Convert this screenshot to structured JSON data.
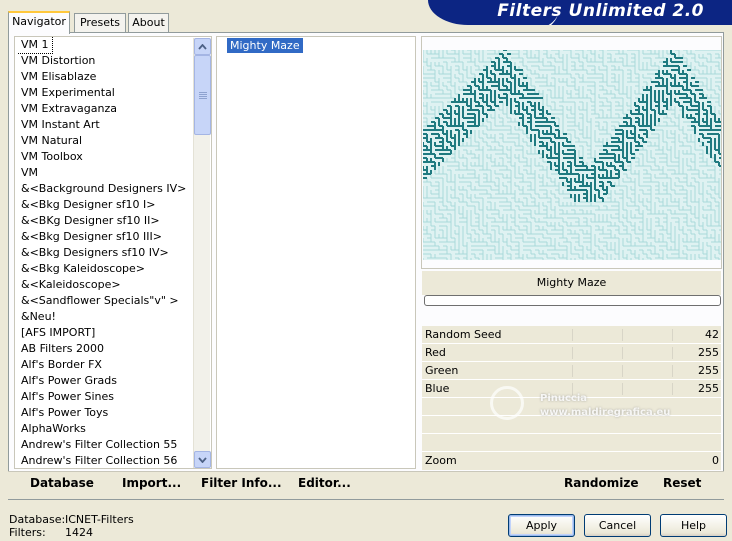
{
  "banner": {
    "title": "Filters Unlimited 2.0"
  },
  "tabs": [
    {
      "label": "Navigator",
      "active": true
    },
    {
      "label": "Presets",
      "active": false
    },
    {
      "label": "About",
      "active": false
    }
  ],
  "categories": [
    "VM 1",
    "VM Distortion",
    "VM Elisablaze",
    "VM Experimental",
    "VM Extravaganza",
    "VM Instant Art",
    "VM Natural",
    "VM Toolbox",
    "VM",
    "&<Background Designers IV>",
    "&<Bkg Designer sf10 I>",
    "&<BKg Designer sf10 II>",
    "&<Bkg Designer sf10 III>",
    "&<Bkg Designers sf10 IV>",
    "&<Bkg Kaleidoscope>",
    "&<Kaleidoscope>",
    "&<Sandflower Specials\"v\" >",
    "&Neu!",
    "[AFS IMPORT]",
    "AB Filters 2000",
    "Alf's Border FX",
    "Alf's Power Grads",
    "Alf's Power Sines",
    "Alf's Power Toys",
    "AlphaWorks",
    "Andrew's Filter Collection 55",
    "Andrew's Filter Collection 56"
  ],
  "selected_category": "VM 1",
  "filters": {
    "selected": "Mighty Maze"
  },
  "preview": {
    "filter_name": "Mighty Maze",
    "maze_color": "#1f7a80",
    "bg_color": "#dff2f2"
  },
  "params": [
    {
      "label": "Random Seed",
      "value": "42"
    },
    {
      "label": "Red",
      "value": "255"
    },
    {
      "label": "Green",
      "value": "255"
    },
    {
      "label": "Blue",
      "value": "255"
    }
  ],
  "zoom": {
    "label": "Zoom",
    "value": "0"
  },
  "toolbar": {
    "database": "Database",
    "import": "Import...",
    "filter_info": "Filter Info...",
    "editor": "Editor...",
    "randomize": "Randomize",
    "reset": "Reset"
  },
  "footer": {
    "database_label": "Database:",
    "database_value": "ICNET-Filters",
    "filters_label": "Filters:",
    "filters_value": "1424"
  },
  "buttons": {
    "apply": "Apply",
    "cancel": "Cancel",
    "help": "Help"
  },
  "watermark": {
    "line1": "Pinuccia",
    "line2": "www.maldiregrafica.eu"
  },
  "colors": {
    "accent": "#316ac5",
    "banner": "#0c2583",
    "tab_highlight": "#ffc83c"
  }
}
